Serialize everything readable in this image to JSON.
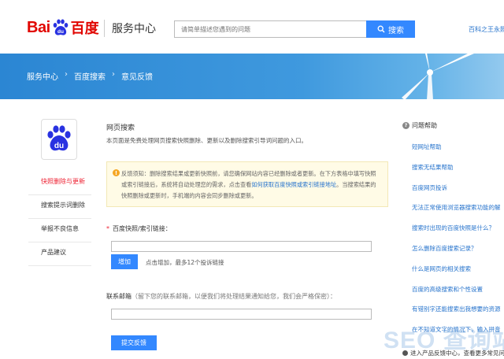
{
  "header": {
    "logo_bai": "Bai",
    "logo_du": "du",
    "logo_cn": "百度",
    "service_label": "服务中心",
    "search_placeholder": "请简单描述您遇到的问题",
    "search_button": "搜索",
    "top_link": "百科之王永照"
  },
  "banner": {
    "crumbs": [
      "服务中心",
      "百度搜索",
      "意见反馈"
    ],
    "sep": "›"
  },
  "sidebar": {
    "items": [
      {
        "label": "快照删除与更新",
        "active": true
      },
      {
        "label": "搜索提示词删除",
        "active": false
      },
      {
        "label": "举报不良信息",
        "active": false
      },
      {
        "label": "产品建议",
        "active": false
      }
    ]
  },
  "main": {
    "title": "网页搜索",
    "description": "本页面是免费处理网页搜索快照删除、更新以及删除搜索引导词问题的入口。",
    "notice": {
      "icon": "!",
      "text_before": "反馈须知：删除搜索结果或更新快照前，请您确保网站内容已经删除或者更新。在下方表格中填写快照或索引链接后，系统将自动处理您的需求，点击查看",
      "link": "如何获取百度快照或索引链接地址",
      "text_after": "。当搜索结果的快照删除或更新时，手机端的内容会同步删除或更新。"
    },
    "field1": {
      "required_mark": "*",
      "label": "百度快照/索引链接："
    },
    "add_button": "增加",
    "add_hint": "点击增加，最多12个投诉链接",
    "field2": {
      "label": "联系邮箱",
      "hint": "（留下您的联系邮箱，以便我们将处理结果通知给您，我们会严格保密）："
    },
    "submit_button": "提交反馈"
  },
  "help": {
    "title": "问题帮助",
    "items": [
      "短网址帮助",
      "搜索无结果帮助",
      "百度网页投诉",
      "无法正常使用浏览器搜索功能的解",
      "搜索时出现的百度快照是什么？",
      "怎么删除百度搜索记录？",
      "什么是网页的相关搜索",
      "百度的高级搜索和个性设置",
      "有错别字还能搜索出我想要的资源",
      "在不知道文字的情况下，输入拼音"
    ],
    "bottom_text": "进入产品反馈中心，查看更多常见问题"
  },
  "watermark": "SEO 查询站长网",
  "colors": {
    "brand_red": "#e10601",
    "brand_blue": "#3388ff",
    "link_blue": "#2673cc"
  }
}
